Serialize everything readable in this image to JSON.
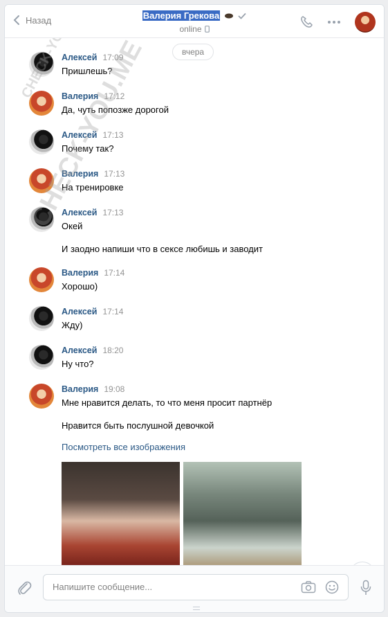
{
  "header": {
    "back_label": "Назад",
    "contact_name": "Валерия Грекова",
    "status": "online"
  },
  "date_divider": "вчера",
  "messages": [
    {
      "author": "Алексей",
      "time": "17:09",
      "text": "Пришлешь?",
      "avatar": "alexey"
    },
    {
      "author": "Валерия",
      "time": "17:12",
      "text": "Да, чуть попозже дорогой",
      "avatar": "valeria"
    },
    {
      "author": "Алексей",
      "time": "17:13",
      "text": "Почему так?",
      "avatar": "alexey"
    },
    {
      "author": "Валерия",
      "time": "17:13",
      "text": "На тренировке",
      "avatar": "valeria"
    },
    {
      "author": "Алексей",
      "time": "17:13",
      "text": "Окей",
      "text2": "И заодно напиши что в сексе любишь и заводит",
      "avatar": "alexey"
    },
    {
      "author": "Валерия",
      "time": "17:14",
      "text": "Хорошо)",
      "avatar": "valeria"
    },
    {
      "author": "Алексей",
      "time": "17:14",
      "text": "Жду)",
      "avatar": "alexey"
    },
    {
      "author": "Алексей",
      "time": "18:20",
      "text": "Ну что?",
      "avatar": "alexey"
    },
    {
      "author": "Валерия",
      "time": "19:08",
      "text": "Мне нравится делать, то что меня просит партнёр",
      "text2": "Нравится быть послушной девочкой",
      "link": "Посмотреть все изображения",
      "avatar": "valeria"
    }
  ],
  "composer": {
    "placeholder": "Напишите сообщение..."
  },
  "watermark": [
    "CHECK-YOU.ME",
    "CHECK-YOU.ME"
  ],
  "colors": {
    "accent": "#2a5885",
    "selection": "#3a6bc4",
    "muted": "#828282"
  },
  "icons": [
    "chevron-left-icon",
    "verified-check-icon",
    "phone-icon",
    "more-icon",
    "paperclip-icon",
    "camera-icon",
    "smile-icon",
    "microphone-icon",
    "chevron-down-icon"
  ]
}
